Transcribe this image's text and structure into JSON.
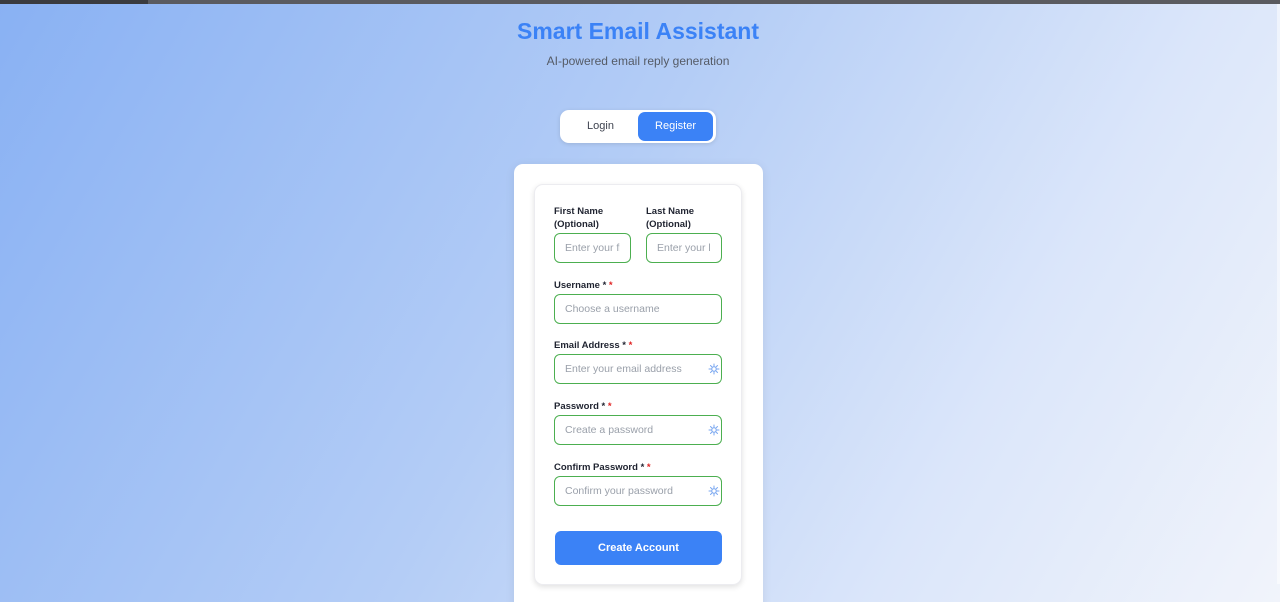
{
  "header": {
    "title": "Smart Email Assistant",
    "subtitle": "AI-powered email reply generation"
  },
  "auth_toggle": {
    "login_label": "Login",
    "register_label": "Register",
    "active": "Register"
  },
  "form": {
    "first_name": {
      "label": "First Name",
      "label_suffix": "(Optional)",
      "placeholder": "Enter your first name"
    },
    "last_name": {
      "label": "Last Name",
      "label_suffix": "(Optional)",
      "placeholder": "Enter your last name"
    },
    "username": {
      "label": "Username *",
      "required_mark": "*",
      "placeholder": "Choose a username"
    },
    "email": {
      "label": "Email Address *",
      "required_mark": "*",
      "placeholder": "Enter your email address",
      "icon": "sparkle-icon"
    },
    "password": {
      "label": "Password *",
      "required_mark": "*",
      "placeholder": "Create a password",
      "icon": "sparkle-icon"
    },
    "confirm_password": {
      "label": "Confirm Password *",
      "required_mark": "*",
      "placeholder": "Confirm your password",
      "icon": "sparkle-icon"
    },
    "submit_label": "Create Account"
  },
  "colors": {
    "accent": "#3b82f6",
    "input_border": "#4caf50",
    "required": "#e02424"
  }
}
